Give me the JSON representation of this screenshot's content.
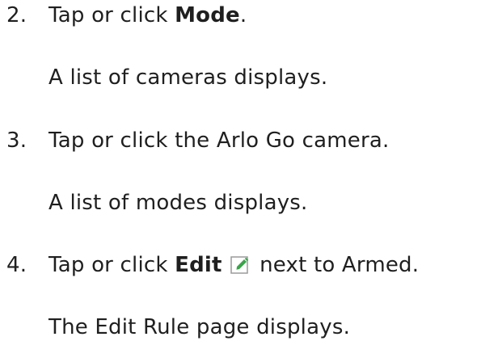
{
  "steps": [
    {
      "number": "2.",
      "prefix": "Tap or click ",
      "bold": "Mode",
      "suffix": ".",
      "result": "A list of cameras displays."
    },
    {
      "number": "3.",
      "text": "Tap or click the Arlo Go camera.",
      "result": "A list of modes displays."
    },
    {
      "number": "4.",
      "prefix": "Tap or click ",
      "bold": "Edit",
      "icon": "edit-pencil-icon",
      "suffix": " next to Armed.",
      "result": "The Edit Rule page displays."
    }
  ],
  "colors": {
    "text": "#1f1f1f",
    "icon_border": "#9a9a9a",
    "icon_pencil": "#3aa44a"
  }
}
